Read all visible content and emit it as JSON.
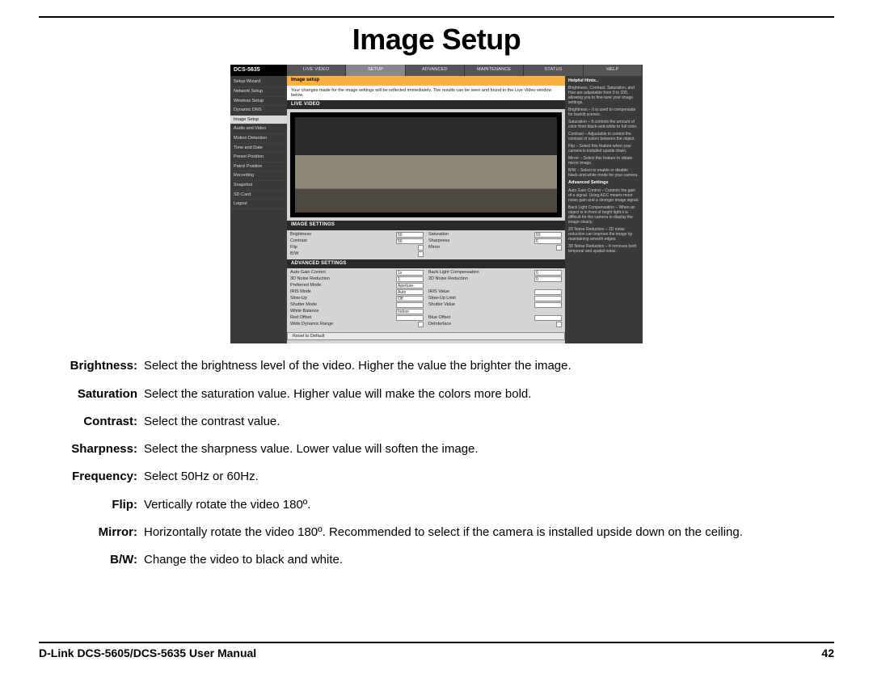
{
  "page": {
    "title": "Image Setup",
    "footer_left": "D-Link DCS-5605/DCS-5635 User Manual",
    "footer_right": "42"
  },
  "screenshot": {
    "logo": "DCS-5635",
    "tabs": [
      "LIVE VIDEO",
      "SETUP",
      "ADVANCED",
      "MAINTENANCE",
      "STATUS",
      "HELP"
    ],
    "active_tab_index": 1,
    "sidebar": [
      "Setup Wizard",
      "Network Setup",
      "Wireless Setup",
      "Dynamic DNS",
      "Image Setup",
      "Audio and Video",
      "Motion Detection",
      "Time and Date",
      "Preset Position",
      "Patrol Position",
      "Recording",
      "Snapshot",
      "SD Card",
      "Logout"
    ],
    "active_sidebar_index": 4,
    "banner": "Image setup",
    "note": "Your changes made for the image settings will be reflected immediately. The results can be seen and found in the Live Video window below.",
    "section_live": "LIVE VIDEO",
    "section_image": "IMAGE SETTINGS",
    "image_settings": [
      {
        "label": "Brightness",
        "value": "50",
        "type": "select"
      },
      {
        "label": "Saturation",
        "value": "50",
        "type": "select"
      },
      {
        "label": "Contrast",
        "value": "50",
        "type": "select"
      },
      {
        "label": "Sharpness",
        "value": "0",
        "type": "select"
      },
      {
        "label": "Flip",
        "value": "",
        "type": "check"
      },
      {
        "label": "Mirror",
        "value": "",
        "type": "check"
      },
      {
        "label": "B/W",
        "value": "",
        "type": "check"
      }
    ],
    "section_advanced": "ADVANCED SETTINGS",
    "advanced_settings": [
      {
        "label": "Auto Gain Control",
        "value": "1x",
        "type": "select"
      },
      {
        "label": "Back Light Compensation",
        "value": "0",
        "type": "select"
      },
      {
        "label": "3D Noise Reduction",
        "value": "1",
        "type": "select"
      },
      {
        "label": "2D Noise Reduction",
        "value": "0",
        "type": "select"
      },
      {
        "label": "Preferred Mode",
        "value": "Aperture-preferred",
        "type": "select"
      },
      {
        "label": "",
        "value": "",
        "type": "blank"
      },
      {
        "label": "IRIS Mode",
        "value": "Auto",
        "type": "select"
      },
      {
        "label": "IRIS Value",
        "value": "",
        "type": "select"
      },
      {
        "label": "Slow-Up",
        "value": "Off",
        "type": "select"
      },
      {
        "label": "Slow-Up Limit",
        "value": "",
        "type": "select"
      },
      {
        "label": "Shutter Mode",
        "value": "",
        "type": "select"
      },
      {
        "label": "Shutter Value",
        "value": "",
        "type": "select"
      },
      {
        "label": "White Balance",
        "value": "Indoor",
        "type": "select"
      },
      {
        "label": "",
        "value": "",
        "type": "blank"
      },
      {
        "label": "Red Offset",
        "value": "",
        "type": "select"
      },
      {
        "label": "Blue Offset",
        "value": "",
        "type": "select"
      },
      {
        "label": "Wide Dynamic Range",
        "value": "",
        "type": "check"
      },
      {
        "label": "DeInterlace",
        "value": "",
        "type": "check"
      }
    ],
    "reset_btn": "Reset to Default",
    "hint_title": "Helpful Hints..",
    "hint_text": "Brightness, Contrast, Saturation, and Hue are adjustable from 0 to 100, allowing you to fine-tune your image settings."
  },
  "definitions": [
    {
      "term": "Brightness:",
      "desc": "Select the brightness level of the video. Higher the value the brighter the image."
    },
    {
      "term": "Saturation",
      "desc": "Select the saturation value. Higher value will make the colors more bold."
    },
    {
      "term": "Contrast:",
      "desc": "Select the contrast value."
    },
    {
      "term": "Sharpness:",
      "desc": "Select the sharpness value. Lower value will soften the image."
    },
    {
      "term": "Frequency:",
      "desc": "Select 50Hz or 60Hz."
    },
    {
      "term": "Flip:",
      "desc": "Vertically rotate the video 180º."
    },
    {
      "term": "Mirror:",
      "desc": "Horizontally rotate the video 180º. Recommended to select if the camera is installed upside down on the ceiling."
    },
    {
      "term": "B/W:",
      "desc": "Change the video to black and white."
    }
  ]
}
